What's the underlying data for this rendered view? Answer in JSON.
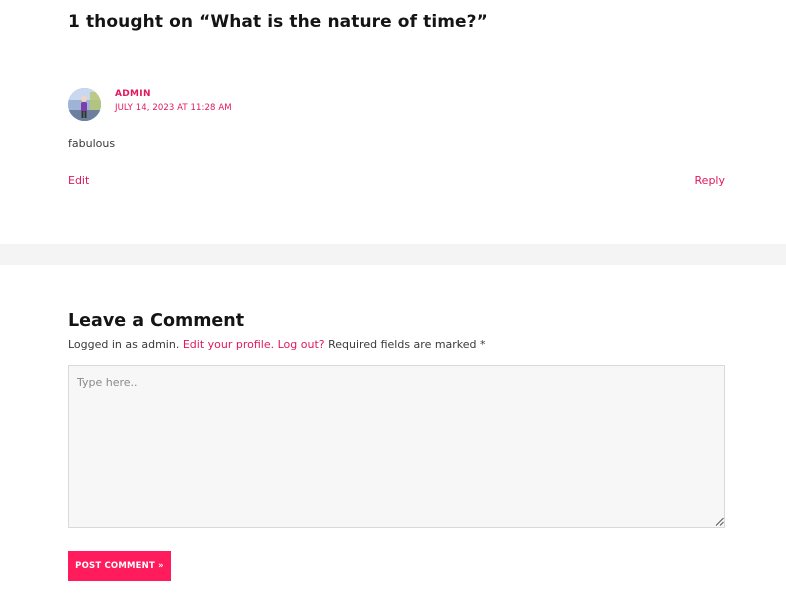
{
  "comments": {
    "title": "1 thought on “What is the nature of time?”",
    "items": [
      {
        "author": "ADMIN",
        "date": "JULY 14, 2023 AT 11:28 AM",
        "text": "fabulous",
        "edit_label": "Edit",
        "reply_label": "Reply"
      }
    ]
  },
  "reply_form": {
    "title": "Leave a Comment",
    "logged_in_prefix": "Logged in as admin.",
    "edit_profile_label": "Edit your profile.",
    "logout_label": "Log out?",
    "required_note": "Required fields are marked *",
    "textarea_placeholder": "Type here..",
    "submit_label": "POST COMMENT »"
  },
  "colors": {
    "accent": "#e2185c",
    "button": "#ff1b5c",
    "band": "#f4f4f4"
  }
}
